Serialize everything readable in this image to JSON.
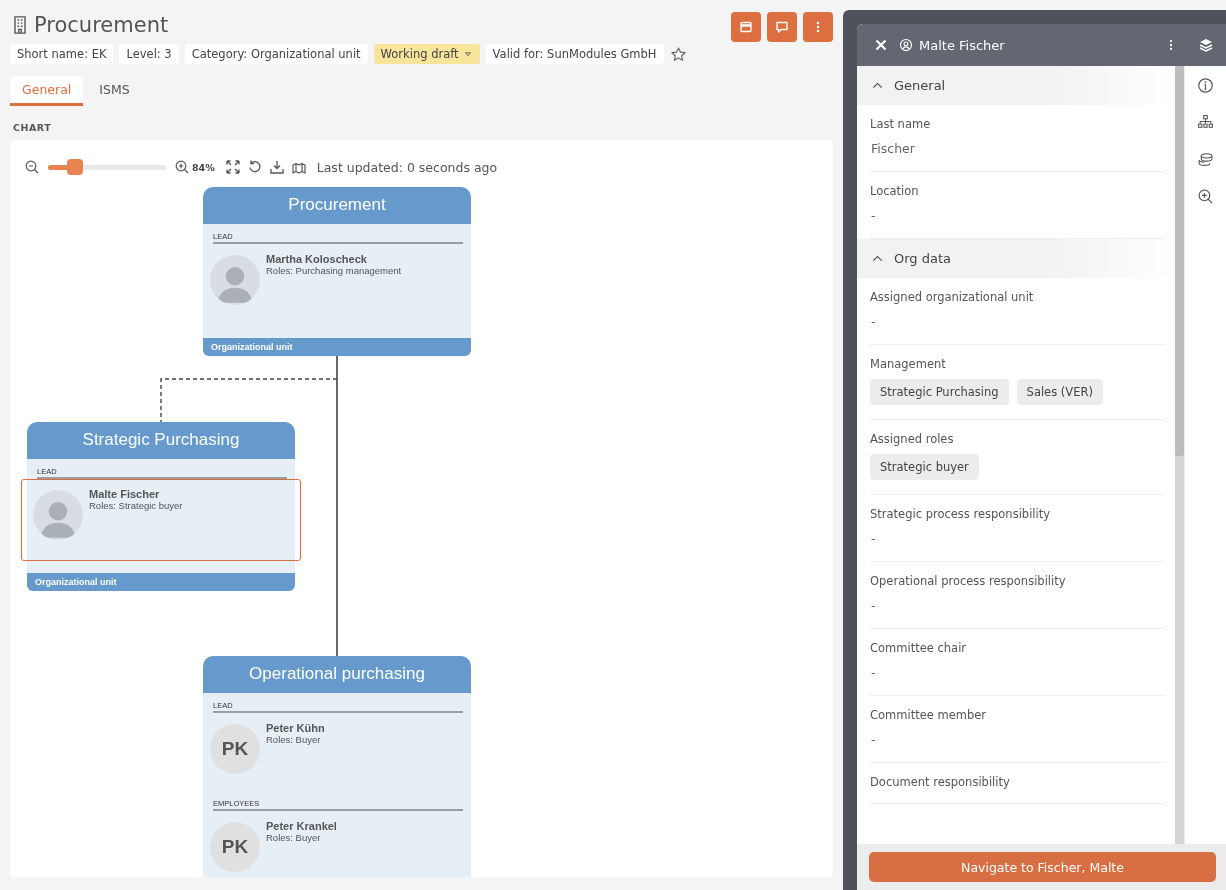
{
  "header": {
    "title": "Procurement",
    "chips": [
      {
        "kind": "plain",
        "label": "Short name: EK"
      },
      {
        "kind": "plain",
        "label": "Level: 3"
      },
      {
        "kind": "plain",
        "label": "Category: Organizational unit"
      },
      {
        "kind": "status",
        "label": "Working draft"
      },
      {
        "kind": "plain",
        "label": "Valid for: SunModules GmbH"
      }
    ],
    "favorite": false
  },
  "tabs": [
    {
      "label": "General",
      "selected": true
    },
    {
      "label": "ISMS",
      "selected": false
    }
  ],
  "section_label": "CHART",
  "chart": {
    "zoom": {
      "level": 0.23,
      "reading": "84%"
    },
    "last_updated": "Last updated: 0 seconds ago",
    "nodes": [
      {
        "title": "Procurement",
        "footer": "Organizational unit",
        "sections": [
          {
            "heading": "LEAD",
            "members": [
              {
                "name": "Martha Koloscheck",
                "roles": "Roles: Purchasing management",
                "avatar": {
                  "kind": "photo"
                },
                "selected": false
              }
            ]
          }
        ]
      },
      {
        "title": "Strategic Purchasing",
        "footer": "Organizational unit",
        "sections": [
          {
            "heading": "LEAD",
            "members": [
              {
                "name": "Malte Fischer",
                "roles": "Roles: Strategic buyer",
                "avatar": {
                  "kind": "photo"
                },
                "selected": true
              }
            ]
          }
        ]
      },
      {
        "title": "Operational purchasing",
        "sections": [
          {
            "heading": "LEAD",
            "members": [
              {
                "name": "Peter Kühn",
                "roles": "Roles: Buyer",
                "avatar": {
                  "kind": "initials",
                  "initials": "PK"
                },
                "selected": false
              }
            ]
          },
          {
            "heading": "EMPLOYEES",
            "members": [
              {
                "name": "Peter Krankel",
                "roles": "Roles: Buyer",
                "avatar": {
                  "kind": "initials",
                  "initials": "PK"
                },
                "selected": false
              }
            ]
          }
        ]
      }
    ]
  },
  "panel": {
    "title": "Malte Fischer",
    "sections": [
      {
        "title": "General",
        "expanded": true,
        "fields": [
          {
            "label": "Last name",
            "value": "Fischer"
          },
          {
            "label": "Location",
            "value": "-"
          }
        ]
      },
      {
        "title": "Org data",
        "expanded": true,
        "fields": [
          {
            "label": "Assigned organizational unit",
            "value": "-"
          },
          {
            "label": "Management",
            "tags": [
              "Strategic Purchasing",
              "Sales (VER)"
            ]
          },
          {
            "label": "Assigned roles",
            "tags": [
              "Strategic buyer"
            ]
          },
          {
            "label": "Strategic process responsibility",
            "value": "-"
          },
          {
            "label": "Operational process responsibility",
            "value": "-"
          },
          {
            "label": "Committee chair",
            "value": "-"
          },
          {
            "label": "Committee member",
            "value": "-"
          },
          {
            "label": "Document responsibility"
          }
        ]
      }
    ],
    "button": "Navigate to Fischer, Malte"
  }
}
